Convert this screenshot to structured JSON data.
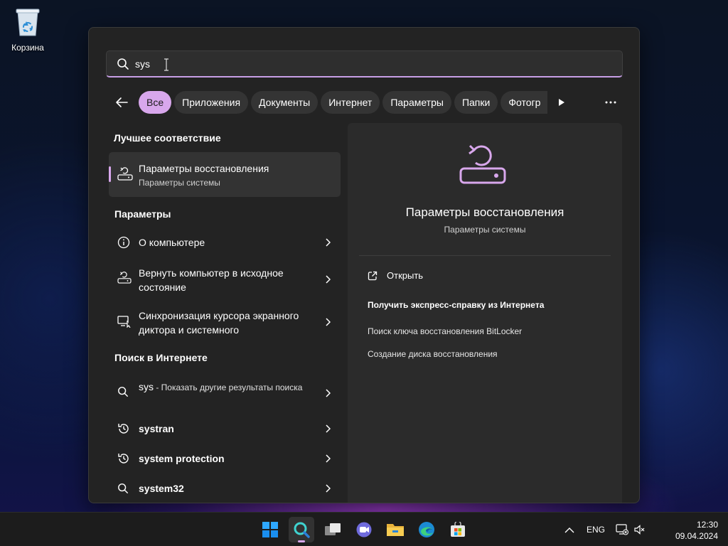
{
  "desktop": {
    "recycle_bin_label": "Корзина"
  },
  "search": {
    "query": "sys"
  },
  "filters": {
    "chips": [
      "Все",
      "Приложения",
      "Документы",
      "Интернет",
      "Параметры",
      "Папки",
      "Фотогр"
    ],
    "active_index": 0
  },
  "best_match": {
    "section_title": "Лучшее соответствие",
    "title": "Параметры восстановления",
    "subtitle": "Параметры системы"
  },
  "settings_section": {
    "title": "Параметры",
    "items": [
      {
        "label": "О компьютере",
        "icon": "info-icon"
      },
      {
        "label": "Вернуть компьютер в исходное состояние",
        "icon": "reset-pc-icon"
      },
      {
        "label": "Синхронизация курсора экранного диктора и системного",
        "icon": "narrator-icon"
      }
    ]
  },
  "web_section": {
    "title": "Поиск в Интернете",
    "items": [
      {
        "label": "sys",
        "suffix": " - Показать другие результаты поиска",
        "icon": "search-icon"
      },
      {
        "label": "systran",
        "icon": "history-icon"
      },
      {
        "label": "system protection",
        "icon": "history-icon"
      },
      {
        "label": "system32",
        "icon": "search-icon"
      }
    ]
  },
  "preview": {
    "title": "Параметры восстановления",
    "subtitle": "Параметры системы",
    "open_label": "Открыть",
    "help_label": "Получить экспресс-справку из Интернета",
    "links": [
      "Поиск ключа восстановления BitLocker",
      "Создание диска восстановления"
    ]
  },
  "taskbar": {
    "apps": [
      "start-icon",
      "search-icon",
      "task-view-icon",
      "chat-icon",
      "file-explorer-icon",
      "edge-icon",
      "store-icon"
    ],
    "language": "ENG",
    "time": "12:30",
    "date": "09.04.2024"
  },
  "colors": {
    "accent": "#d8a7ec",
    "panel": "#232323",
    "preview": "#2b2b2b"
  }
}
